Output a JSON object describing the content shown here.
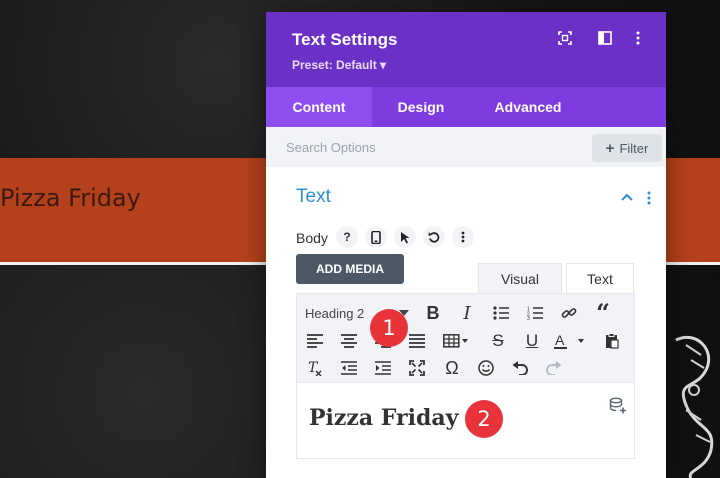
{
  "background": {
    "heading": "Pizza Friday",
    "band_color": "#b5411c"
  },
  "panel": {
    "title": "Text Settings",
    "preset": "Preset: Default ▾",
    "header_icons": [
      "expand-icon",
      "split-view-icon",
      "more-vertical-icon"
    ],
    "tabs": [
      {
        "label": "Content",
        "active": true
      },
      {
        "label": "Design",
        "active": false
      },
      {
        "label": "Advanced",
        "active": false
      }
    ],
    "search": {
      "placeholder": "Search Options",
      "value": ""
    },
    "filter_label": "Filter",
    "section": {
      "title": "Text"
    },
    "body_label": "Body",
    "add_media_label": "ADD MEDIA",
    "editor_modes": {
      "visual": "Visual",
      "text": "Text"
    },
    "toolbar": {
      "heading_select": "Heading 2"
    },
    "editor": {
      "content": "Pizza Friday"
    }
  },
  "annotations": {
    "marker1": "1",
    "marker2": "2"
  },
  "colors": {
    "header": "#6b31c7",
    "tabs": "#7e3be0",
    "active_tab": "#8f4ff0",
    "section_title": "#2f8fd6",
    "marker": "#e8333a"
  }
}
